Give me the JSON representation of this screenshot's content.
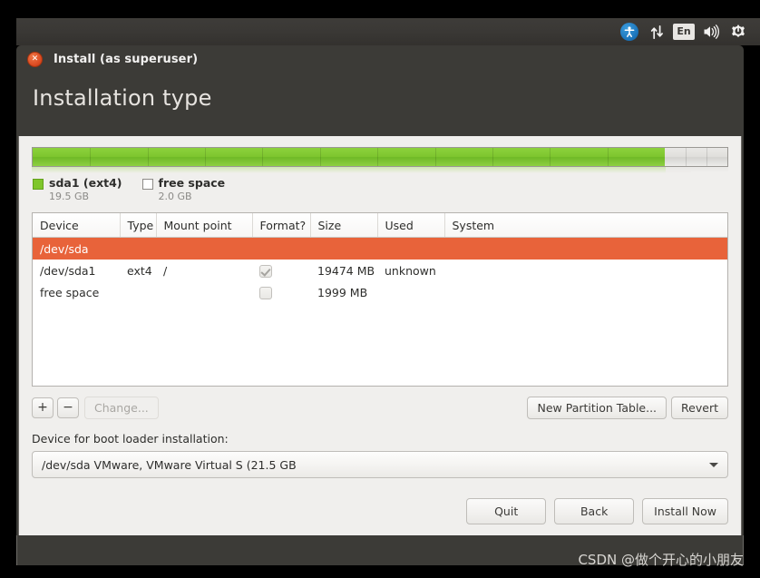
{
  "top_panel": {
    "icons": [
      {
        "name": "accessibility-icon",
        "label": "Accessibility"
      },
      {
        "name": "network-icon",
        "label": "Network"
      },
      {
        "name": "keyboard-layout-indicator",
        "label": "En"
      },
      {
        "name": "volume-icon",
        "label": "Volume"
      },
      {
        "name": "system-settings-icon",
        "label": "System"
      }
    ]
  },
  "window": {
    "close_glyph": "✕",
    "titlebar_text": "Install (as superuser)",
    "page_title": "Installation type"
  },
  "partition_bar": {
    "segments": [
      {
        "name": "sda1",
        "percent": 91,
        "kind": "used"
      },
      {
        "name": "free space",
        "percent": 9,
        "kind": "free"
      }
    ]
  },
  "legend": [
    {
      "name": "sda1 (ext4)",
      "size": "19.5 GB",
      "swatch": "green"
    },
    {
      "name": "free space",
      "size": "2.0 GB",
      "swatch": "white"
    }
  ],
  "table": {
    "columns": [
      "Device",
      "Type",
      "Mount point",
      "Format?",
      "Size",
      "Used",
      "System"
    ],
    "rows": [
      {
        "kind": "disk",
        "device": "/dev/sda",
        "type": "",
        "mount_point": "",
        "format": null,
        "size": "",
        "used": "",
        "system": ""
      },
      {
        "kind": "partition",
        "device": "/dev/sda1",
        "type": "ext4",
        "mount_point": "/",
        "format": "checked",
        "size": "19474 MB",
        "used": "unknown",
        "system": ""
      },
      {
        "kind": "partition",
        "device": "free space",
        "type": "",
        "mount_point": "",
        "format": "unchecked",
        "size": "1999 MB",
        "used": "",
        "system": ""
      }
    ]
  },
  "toolbar": {
    "add_label": "+",
    "remove_label": "−",
    "change_label": "Change...",
    "new_partition_table_label": "New Partition Table...",
    "revert_label": "Revert"
  },
  "bootloader": {
    "label": "Device for boot loader installation:",
    "value": "/dev/sda   VMware, VMware Virtual S (21.5 GB"
  },
  "actions": {
    "quit_label": "Quit",
    "back_label": "Back",
    "install_label": "Install Now"
  },
  "watermark": {
    "text": "CSDN @做个开心的小朋友"
  },
  "colors": {
    "accent_selected_row": "#e8633a",
    "partition_used": "#7fc62b",
    "window_chrome": "#3c3b37",
    "content_bg": "#f0efed"
  }
}
